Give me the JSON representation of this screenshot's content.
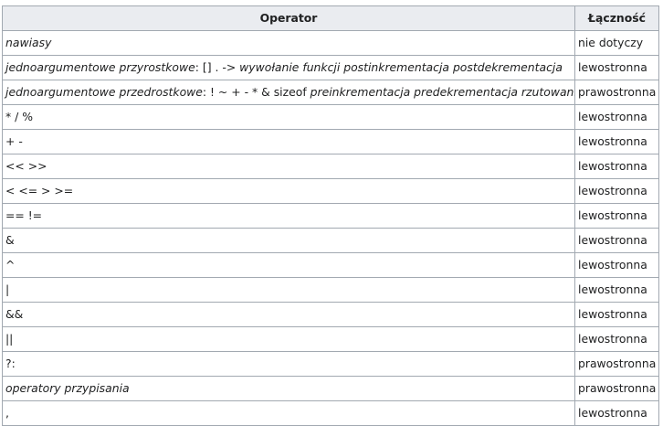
{
  "table": {
    "headers": {
      "operator": "Operator",
      "associativity": "Łączność"
    },
    "rows": [
      {
        "operator": [
          {
            "text": "nawiasy",
            "italic": true
          }
        ],
        "associativity": "nie dotyczy"
      },
      {
        "operator": [
          {
            "text": "jednoargumentowe przyrostkowe",
            "italic": true
          },
          {
            "text": ": [] . -> ",
            "italic": false
          },
          {
            "text": "wywołanie funkcji postinkrementacja postdekrementacja",
            "italic": true
          }
        ],
        "associativity": "lewostronna"
      },
      {
        "operator": [
          {
            "text": "jednoargumentowe przedrostkowe",
            "italic": true
          },
          {
            "text": ": ! ~ + - * & sizeof ",
            "italic": false
          },
          {
            "text": "preinkrementacja predekrementacja rzutowanie",
            "italic": true
          }
        ],
        "associativity": "prawostronna"
      },
      {
        "operator": [
          {
            "text": "* / %",
            "italic": false
          }
        ],
        "associativity": "lewostronna"
      },
      {
        "operator": [
          {
            "text": "+ -",
            "italic": false
          }
        ],
        "associativity": "lewostronna"
      },
      {
        "operator": [
          {
            "text": "<< >>",
            "italic": false
          }
        ],
        "associativity": "lewostronna"
      },
      {
        "operator": [
          {
            "text": "< <= > >=",
            "italic": false
          }
        ],
        "associativity": "lewostronna"
      },
      {
        "operator": [
          {
            "text": "== !=",
            "italic": false
          }
        ],
        "associativity": "lewostronna"
      },
      {
        "operator": [
          {
            "text": "&",
            "italic": false
          }
        ],
        "associativity": "lewostronna"
      },
      {
        "operator": [
          {
            "text": "^",
            "italic": false
          }
        ],
        "associativity": "lewostronna"
      },
      {
        "operator": [
          {
            "text": "|",
            "italic": false
          }
        ],
        "associativity": "lewostronna"
      },
      {
        "operator": [
          {
            "text": "&&",
            "italic": false
          }
        ],
        "associativity": "lewostronna"
      },
      {
        "operator": [
          {
            "text": "||",
            "italic": false
          }
        ],
        "associativity": "lewostronna"
      },
      {
        "operator": [
          {
            "text": "?:",
            "italic": false
          }
        ],
        "associativity": "prawostronna"
      },
      {
        "operator": [
          {
            "text": "operatory przypisania",
            "italic": true
          }
        ],
        "associativity": "prawostronna"
      },
      {
        "operator": [
          {
            "text": ",",
            "italic": false
          }
        ],
        "associativity": "lewostronna"
      }
    ]
  },
  "colors": {
    "header_background": "#eaecf0",
    "border": "#a2a9b1",
    "text": "#202122",
    "cell_background": "#ffffff"
  }
}
